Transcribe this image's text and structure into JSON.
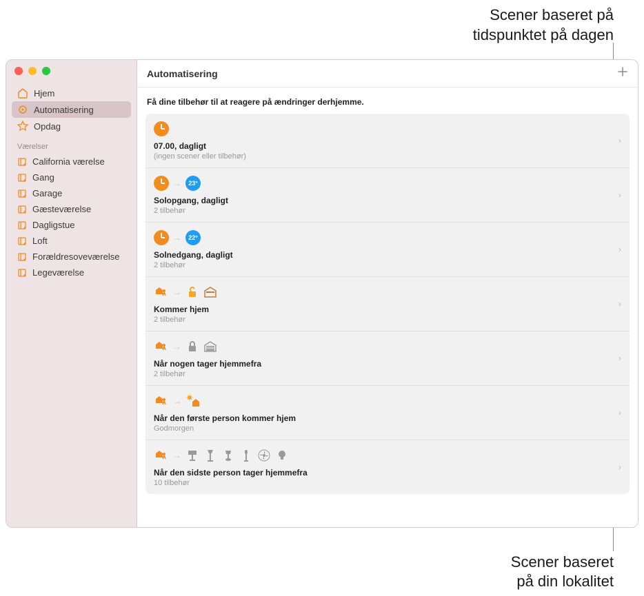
{
  "annotations": {
    "top": "Scener baseret på\ntidspunktet på dagen",
    "bottom": "Scener baseret\npå din lokalitet"
  },
  "window": {
    "title": "Automatisering",
    "subtitle": "Få dine tilbehør til at reagere på ændringer derhjemme."
  },
  "sidebar": {
    "nav": [
      {
        "label": "Hjem",
        "icon": "house"
      },
      {
        "label": "Automatisering",
        "icon": "gear",
        "selected": true
      },
      {
        "label": "Opdag",
        "icon": "star"
      }
    ],
    "section_label": "Værelser",
    "rooms": [
      "California værelse",
      "Gang",
      "Garage",
      "Gæsteværelse",
      "Dagligstue",
      "Loft",
      "Forældresoveværelse",
      "Legeværelse"
    ]
  },
  "automations": [
    {
      "title": "07.00, dagligt",
      "sub": "(ingen scener eller tilbehør)",
      "type": "time",
      "icons": [
        "clock"
      ]
    },
    {
      "title": "Solopgang, dagligt",
      "sub": "2 tilbehør",
      "type": "time",
      "icons": [
        "clock",
        "arrow",
        "temp23"
      ]
    },
    {
      "title": "Solnedgang, dagligt",
      "sub": "2 tilbehør",
      "type": "time",
      "icons": [
        "clock",
        "arrow",
        "temp22"
      ]
    },
    {
      "title": "Kommer hjem",
      "sub": "2 tilbehør",
      "type": "location",
      "icons": [
        "person",
        "arrow",
        "unlock",
        "garage-open"
      ]
    },
    {
      "title": "Når nogen tager hjemmefra",
      "sub": "2 tilbehør",
      "type": "location",
      "icons": [
        "person",
        "arrow",
        "lock",
        "garage-closed"
      ]
    },
    {
      "title": "Når den første person kommer hjem",
      "sub": "Godmorgen",
      "type": "location",
      "icons": [
        "person",
        "arrow",
        "sunhouse"
      ]
    },
    {
      "title": "Når den sidste person tager hjemmefra",
      "sub": "10 tilbehør",
      "type": "location",
      "icons": [
        "person",
        "arrow",
        "lamp",
        "lamp2",
        "lamp3",
        "lamp4",
        "fan",
        "bulb"
      ]
    }
  ],
  "temps": {
    "temp23": "23°",
    "temp22": "22°"
  }
}
